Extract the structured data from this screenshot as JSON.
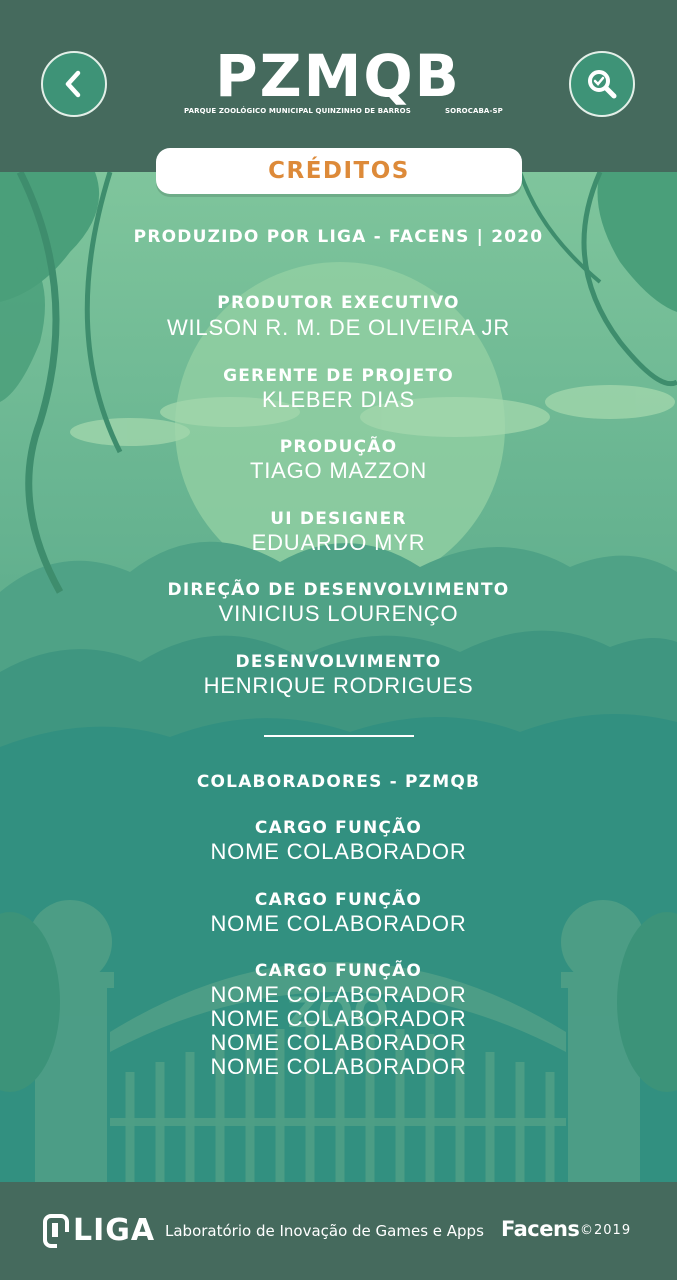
{
  "header": {
    "logo": {
      "wordmark": "PZMQB",
      "subtitle": "PARQUE ZOOLÓGICO MUNICIPAL QUINZINHO DE BARROS",
      "location": "SOROCABA-SP"
    },
    "back_icon": "chevron-left-icon",
    "search_icon": "search-icon"
  },
  "title": "CRÉDITOS",
  "produced_by": "PRODUZIDO POR LIGA - FACENS | 2020",
  "credits": [
    {
      "role": "PRODUTOR EXECUTIVO",
      "name": "WILSON R. M. DE OLIVEIRA JR"
    },
    {
      "role": "GERENTE DE PROJETO",
      "name": "KLEBER DIAS"
    },
    {
      "role": "PRODUÇÃO",
      "name": "TIAGO MAZZON"
    },
    {
      "role": "UI DESIGNER",
      "name": "EDUARDO MYR"
    },
    {
      "role": "DIREÇÃO DE DESENVOLVIMENTO",
      "name": "VINICIUS LOURENÇO"
    },
    {
      "role": "DESENVOLVIMENTO",
      "name": "HENRIQUE RODRIGUES"
    }
  ],
  "collaborators": {
    "heading": "COLABORADORES - PZMQB",
    "groups": [
      {
        "role": "CARGO FUNÇÃO",
        "names": [
          "NOME COLABORADOR"
        ]
      },
      {
        "role": "CARGO FUNÇÃO",
        "names": [
          "NOME COLABORADOR"
        ]
      },
      {
        "role": "CARGO FUNÇÃO",
        "names": [
          "NOME COLABORADOR",
          "NOME COLABORADOR",
          "NOME COLABORADOR",
          "NOME COLABORADOR"
        ]
      }
    ]
  },
  "footer": {
    "liga": "LIGA",
    "lab": "Laboratório de Inovação de Games e Apps",
    "facens": "Facens",
    "copyright": "©2019"
  },
  "colors": {
    "header": "#456a5d",
    "accent": "#dd8a39",
    "background": "#3f8f7c"
  }
}
